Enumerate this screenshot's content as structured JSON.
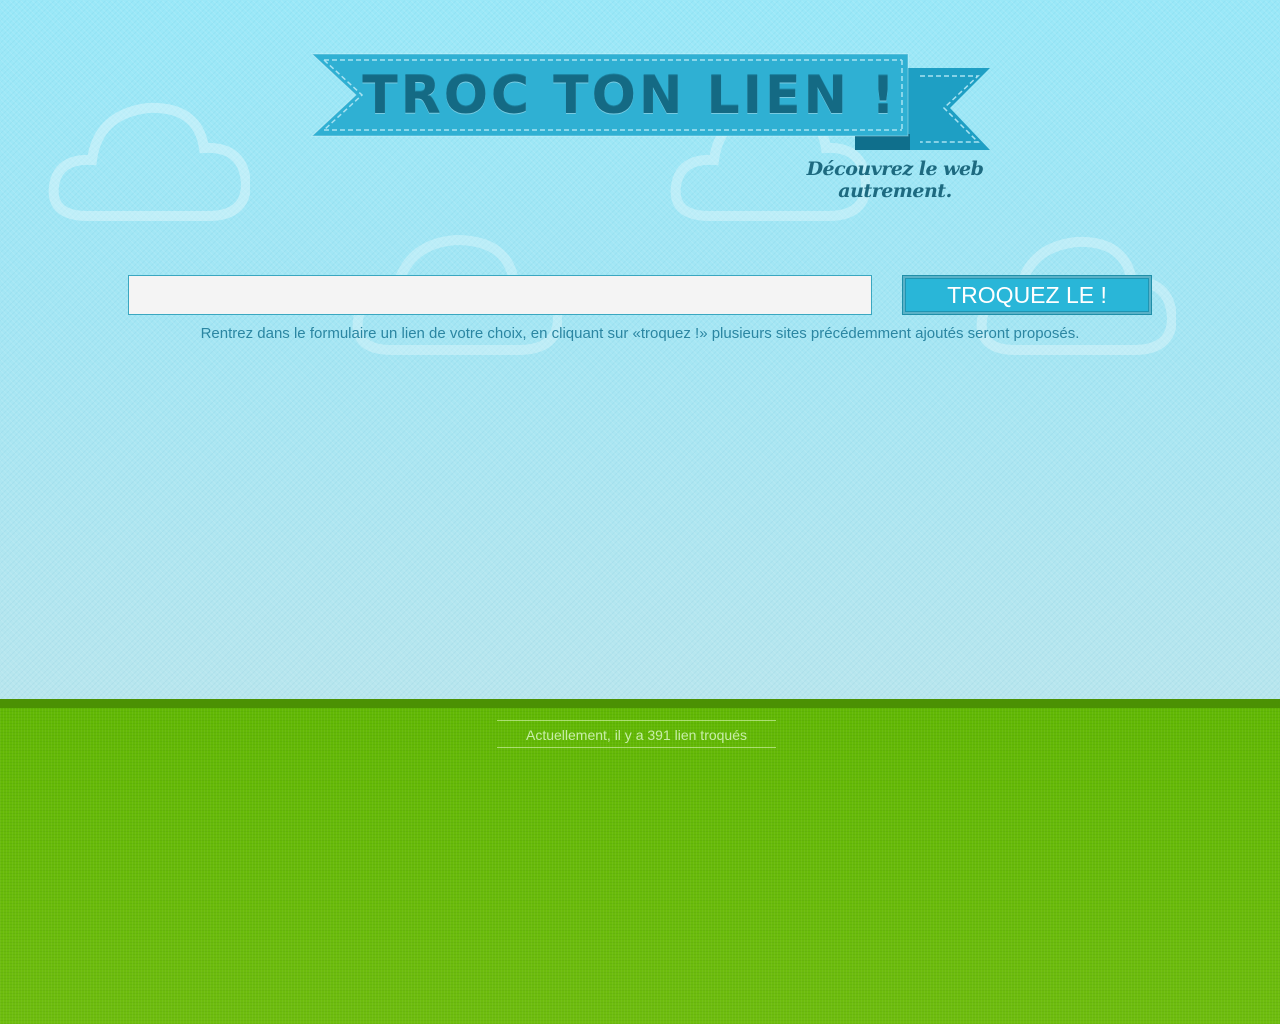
{
  "header": {
    "logo_text": "TROC TON LIEN !",
    "tagline": "Découvrez le web autrement."
  },
  "form": {
    "input_value": "",
    "input_placeholder": "",
    "submit_label": "TROQUEZ LE !",
    "help_text": "Rentrez dans le formulaire un lien de votre choix, en cliquant sur «troquez !» plusieurs sites précédemment ajoutés seront proposés."
  },
  "footer": {
    "counter_text": "Actuellement, il y a 391 lien troqués"
  },
  "colors": {
    "sky": "#a7e9f5",
    "ribbon": "#2fb0d3",
    "ribbon_dark": "#178fb0",
    "button": "#29b6d8",
    "grass": "#65ba05",
    "grass_edge": "#4b9103",
    "text_dark": "#146a84"
  }
}
